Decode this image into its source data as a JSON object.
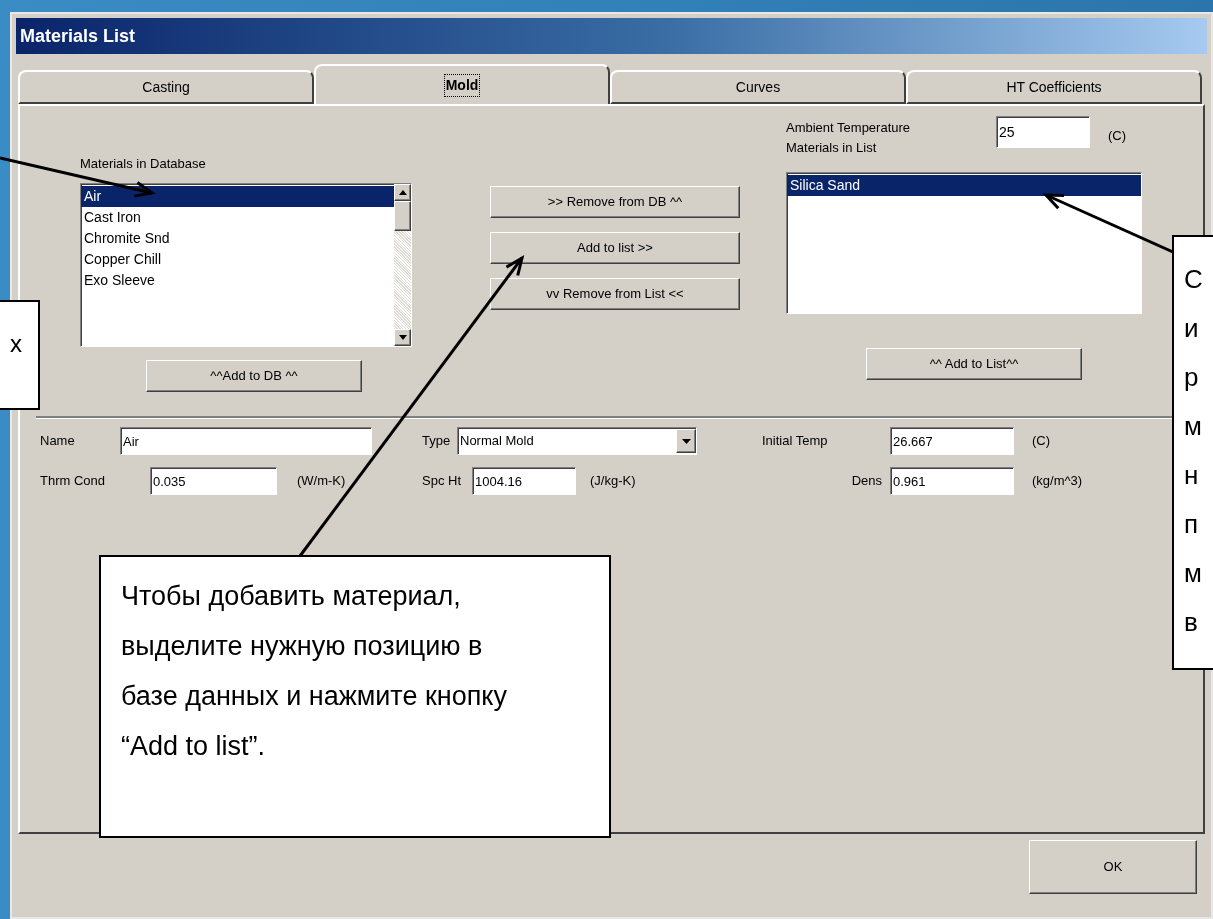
{
  "window": {
    "title": "Materials List"
  },
  "tabs": [
    {
      "label": "Casting",
      "selected": false
    },
    {
      "label": "Mold",
      "selected": true
    },
    {
      "label": "Curves",
      "selected": false
    },
    {
      "label": "HT Coefficients",
      "selected": false
    }
  ],
  "database": {
    "label": "Materials in Database",
    "items": [
      {
        "label": "Air",
        "selected": true
      },
      {
        "label": "Cast Iron",
        "selected": false
      },
      {
        "label": "Chromite Snd",
        "selected": false
      },
      {
        "label": "Copper Chill",
        "selected": false
      },
      {
        "label": "Exo Sleeve",
        "selected": false
      }
    ],
    "button": "^^Add to DB ^^"
  },
  "middle_buttons": [
    ">> Remove from DB ^^",
    "Add to list >>",
    "vv Remove from List <<"
  ],
  "ambient": {
    "label": "Ambient Temperature",
    "value": "25",
    "unit": "(C)"
  },
  "list": {
    "label": "Materials in List",
    "items": [
      {
        "label": "Silica Sand",
        "selected": true
      }
    ],
    "button": "^^ Add to List^^"
  },
  "properties": {
    "rows": [
      [
        {
          "label": "Name",
          "value": "Air",
          "kind": "text"
        },
        {
          "label": "Type",
          "value": "Normal Mold",
          "kind": "select"
        },
        {
          "label": "Initial Temp",
          "value": "26.667",
          "unit": "(C)",
          "kind": "text"
        }
      ],
      [
        {
          "label": "Thrm Cond",
          "value": "0.035",
          "unit": "(W/m-K)",
          "kind": "text"
        },
        {
          "label": "Spc Ht",
          "value": "1004.16",
          "unit": "(J/kg-K)",
          "kind": "text"
        },
        {
          "label": "Dens",
          "value": "0.961",
          "unit": "(kg/m^3)",
          "kind": "text"
        }
      ]
    ]
  },
  "ok": "OK",
  "callouts": {
    "left": {
      "lines": [
        "х"
      ]
    },
    "center": {
      "text": "Чтобы добавить материал, выделите нужную позицию в базе данных и нажмите кнопку “Add to list”."
    },
    "right": {
      "lines": [
        "С",
        "и",
        "р",
        "м",
        "н",
        "п",
        "м",
        "в"
      ]
    }
  }
}
